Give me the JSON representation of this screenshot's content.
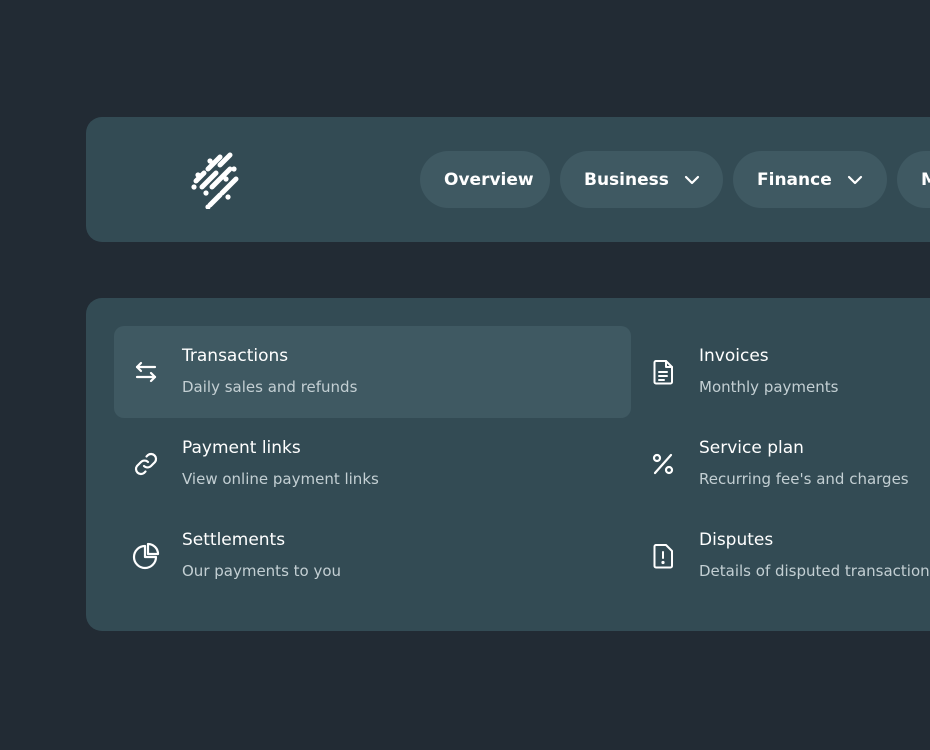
{
  "nav": {
    "logo": "brand-logo",
    "items": [
      {
        "label": "Overview",
        "has_dropdown": false
      },
      {
        "label": "Business",
        "has_dropdown": true
      },
      {
        "label": "Finance",
        "has_dropdown": true
      },
      {
        "label": "M",
        "has_dropdown": false
      }
    ]
  },
  "menu": {
    "items": [
      {
        "title": "Transactions",
        "description": "Daily sales and refunds",
        "icon": "arrows-exchange-icon",
        "active": true
      },
      {
        "title": "Invoices",
        "description": "Monthly payments",
        "icon": "document-icon",
        "active": false
      },
      {
        "title": "Payment links",
        "description": "View online payment links",
        "icon": "link-icon",
        "active": false
      },
      {
        "title": "Service plan",
        "description": "Recurring fee's and charges",
        "icon": "percent-icon",
        "active": false
      },
      {
        "title": "Settlements",
        "description": "Our payments to you",
        "icon": "pie-chart-icon",
        "active": false
      },
      {
        "title": "Disputes",
        "description": "Details of disputed transactions",
        "icon": "alert-document-icon",
        "active": false
      }
    ]
  },
  "colors": {
    "background": "#222b34",
    "panel": "#334b54",
    "pill": "#3f5962",
    "text": "#ffffff",
    "muted_text": "#c3cfd3"
  }
}
